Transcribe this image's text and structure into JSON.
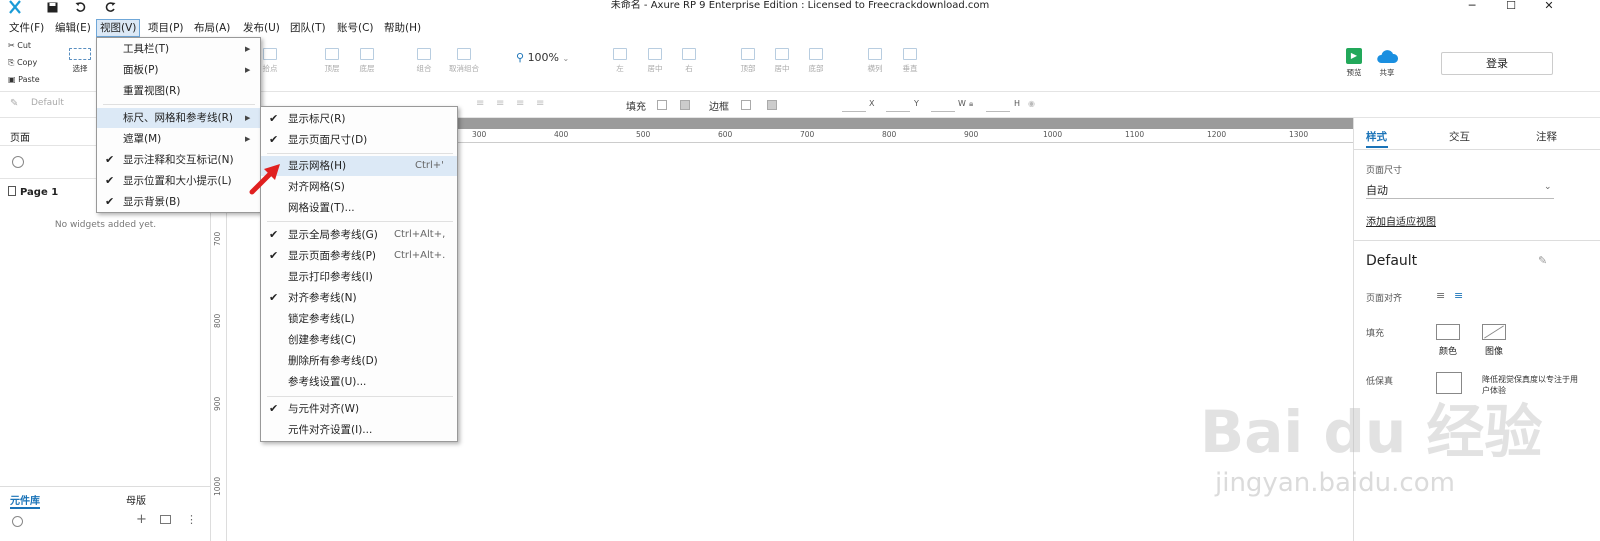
{
  "window": {
    "title": "未命名 - Axure RP 9 Enterprise Edition : Licensed to Freecrackdownload.com",
    "minimize": "─",
    "maximize": "☐",
    "close": "✕"
  },
  "menubar": [
    {
      "label": "文件(F)"
    },
    {
      "label": "编辑(E)"
    },
    {
      "label": "视图(V)"
    },
    {
      "label": "项目(P)"
    },
    {
      "label": "布局(A)"
    },
    {
      "label": "发布(U)"
    },
    {
      "label": "团队(T)"
    },
    {
      "label": "账号(C)"
    },
    {
      "label": "帮助(H)"
    }
  ],
  "clipboard": {
    "cut": "Cut",
    "copy": "Copy",
    "paste": "Paste"
  },
  "toolbar": {
    "select_label": "选择",
    "buttons": [
      "拾点",
      "顶层",
      "底层",
      "组合",
      "取消组合",
      "左",
      "居中",
      "右",
      "顶部",
      "居中",
      "底部",
      "横列",
      "垂直"
    ],
    "zoom": "100%",
    "preview": "预览",
    "share": "共享",
    "login": "登录"
  },
  "format_bar": {
    "style": "Default",
    "fill": "填充",
    "border": "边框",
    "x": "X",
    "y": "Y",
    "w": "W",
    "h": "H"
  },
  "left_panel": {
    "pages_title": "页面",
    "page_name": "Page 1",
    "empty_text": "No widgets added yet.",
    "bottom_tab_library": "元件库",
    "bottom_tab_masters": "母版"
  },
  "ruler": {
    "h_ticks": [
      "300",
      "400",
      "500",
      "600",
      "700",
      "800",
      "900",
      "1000",
      "1100",
      "1200",
      "1300"
    ],
    "v_ticks": [
      "700",
      "800",
      "900",
      "1000"
    ]
  },
  "right_panel": {
    "tabs": [
      "样式",
      "交互",
      "注释"
    ],
    "page_size_label": "页面尺寸",
    "page_size_value": "自动",
    "adaptive_link": "添加自适应视图",
    "style_name": "Default",
    "page_align_label": "页面对齐",
    "fill_label": "填充",
    "fill_color": "颜色",
    "fill_image": "图像",
    "low_fidelity_label": "低保真",
    "low_fidelity_desc": "降低视觉保真度以专注于用户体验"
  },
  "view_menu": [
    {
      "label": "工具栏(T)",
      "submenu": true
    },
    {
      "label": "面板(P)",
      "submenu": true
    },
    {
      "label": "重置视图(R)"
    },
    {
      "label": "标尺、网格和参考线(R)",
      "submenu": true,
      "highlight": true
    },
    {
      "label": "遮罩(M)",
      "submenu": true
    },
    {
      "label": "显示注释和交互标记(N)",
      "checked": true
    },
    {
      "label": "显示位置和大小提示(L)",
      "checked": true
    },
    {
      "label": "显示背景(B)",
      "checked": true
    }
  ],
  "grid_menu": [
    {
      "label": "显示标尺(R)",
      "checked": true,
      "shortcut": ""
    },
    {
      "label": "显示页面尺寸(D)",
      "checked": true,
      "shortcut": ""
    },
    {
      "label": "显示网格(H)",
      "checked": false,
      "shortcut": "Ctrl+'",
      "highlight": true
    },
    {
      "label": "对齐网格(S)",
      "checked": false,
      "shortcut": ""
    },
    {
      "label": "网格设置(T)...",
      "checked": false,
      "shortcut": ""
    },
    {
      "label": "显示全局参考线(G)",
      "checked": true,
      "shortcut": "Ctrl+Alt+,"
    },
    {
      "label": "显示页面参考线(P)",
      "checked": true,
      "shortcut": "Ctrl+Alt+."
    },
    {
      "label": "显示打印参考线(I)",
      "checked": false,
      "shortcut": ""
    },
    {
      "label": "对齐参考线(N)",
      "checked": true,
      "shortcut": ""
    },
    {
      "label": "锁定参考线(L)",
      "checked": false,
      "shortcut": ""
    },
    {
      "label": "创建参考线(C)",
      "checked": false,
      "shortcut": ""
    },
    {
      "label": "删除所有参考线(D)",
      "checked": false,
      "shortcut": ""
    },
    {
      "label": "参考线设置(U)...",
      "checked": false,
      "shortcut": ""
    },
    {
      "label": "与元件对齐(W)",
      "checked": true,
      "shortcut": ""
    },
    {
      "label": "元件对齐设置(I)...",
      "checked": false,
      "shortcut": ""
    }
  ],
  "check_mark": "✔",
  "submenu_arrow": "▶",
  "watermark": {
    "main": "Bai du 经验",
    "sub": "jingyan.baidu.com"
  },
  "colors": {
    "accent": "#1a73b8",
    "menu_highlight": "#dce9f6",
    "arrow": "#e02020"
  }
}
